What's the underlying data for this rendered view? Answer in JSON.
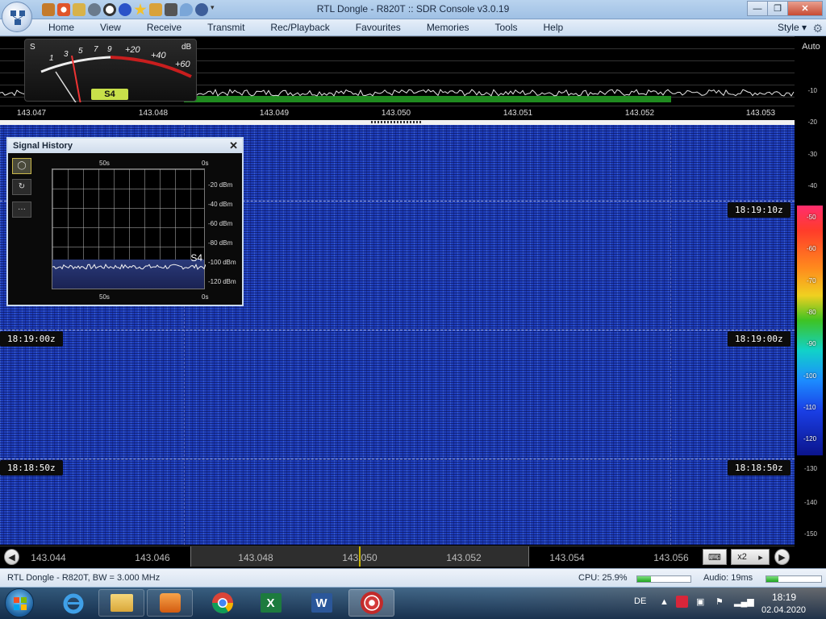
{
  "window": {
    "title": "RTL Dongle - R820T :: SDR Console v3.0.19",
    "minimize": "—",
    "restore": "❐",
    "close": "✕"
  },
  "menu": {
    "items": [
      "Home",
      "View",
      "Receive",
      "Transmit",
      "Rec/Playback",
      "Favourites",
      "Memories",
      "Tools",
      "Help"
    ],
    "style_label": "Style",
    "style_arrow": "▾"
  },
  "meter": {
    "s_label": "S",
    "db_label": "dB",
    "scale": [
      "1",
      "3",
      "5",
      "7",
      "9",
      "+20",
      "+40",
      "+60"
    ],
    "reading": "S4"
  },
  "spectrum": {
    "frequencies": [
      "143.047",
      "143.048",
      "143.049",
      "143.050",
      "143.051",
      "143.052",
      "143.053"
    ]
  },
  "right_scale": {
    "auto_label": "Auto",
    "ticks_upper": [
      "-10",
      "-20",
      "-30",
      "-40"
    ],
    "colorbar_ticks": [
      "-50",
      "-60",
      "-70",
      "-80",
      "-90",
      "-100",
      "-110",
      "-120"
    ],
    "ticks_lower": [
      "-130",
      "-140",
      "-150"
    ]
  },
  "waterfall": {
    "left_times": [
      "18:19:00z",
      "18:18:50z"
    ],
    "right_times": [
      "18:19:10z",
      "18:19:00z",
      "18:18:50z"
    ]
  },
  "signal_history": {
    "title": "Signal History",
    "close": "✕",
    "tools": [
      "◯",
      "↻",
      "···"
    ],
    "top_axis": [
      "50s",
      "0s"
    ],
    "bottom_axis": [
      "50s",
      "0s"
    ],
    "db_labels": [
      "-20 dBm",
      "-40 dBm",
      "-60 dBm",
      "-80 dBm",
      "-100 dBm",
      "-120 dBm"
    ],
    "s_reading": "S4"
  },
  "band": {
    "frequencies": [
      "143.044",
      "143.046",
      "143.048",
      "143.050",
      "143.052",
      "143.054",
      "143.056"
    ],
    "zoom": "x2",
    "zoom_arrow": "▸",
    "keyboard_icon": "⌨",
    "prev": "◀",
    "next": "▶"
  },
  "status": {
    "device": "RTL Dongle - R820T, BW = 3.000 MHz",
    "cpu_label": "CPU: 25.9%",
    "cpu_level": 0.259,
    "audio_label": "Audio: 19ms",
    "audio_level": 0.22
  },
  "taskbar": {
    "language": "DE",
    "time": "18:19",
    "date": "02.04.2020",
    "word_letter": "W",
    "excel_letter": "X"
  }
}
